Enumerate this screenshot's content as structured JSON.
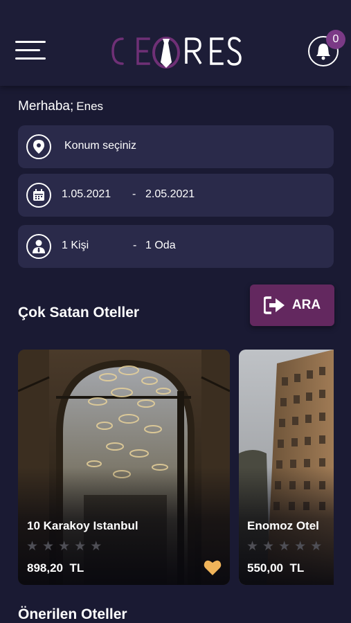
{
  "header": {
    "logo_text": "CEIRES",
    "notification_count": "0"
  },
  "greeting": {
    "label": "Merhaba;",
    "name": "Enes"
  },
  "search": {
    "location_placeholder": "Konum seçiniz",
    "checkin": "1.05.2021",
    "checkout": "2.05.2021",
    "date_separator": "-",
    "guests": "1 Kişi",
    "rooms": "1 Oda",
    "guest_separator": "-",
    "search_button": "ARA"
  },
  "sections": {
    "bestsellers_title": "Çok Satan Oteller",
    "recommended_title": "Önerilen Oteller"
  },
  "hotels": [
    {
      "name": "10 Karakoy Istanbul",
      "price": "898,20",
      "currency": "TL",
      "rating": 0,
      "favorite": true
    },
    {
      "name": "Enomoz Otel",
      "price": "550,00",
      "currency": "TL",
      "rating": 0,
      "favorite": false
    }
  ],
  "colors": {
    "background": "#1a1a33",
    "field": "#2a2a4a",
    "accent": "#63285f",
    "badge": "#7b3a86",
    "favorite": "#f0b45a",
    "star_empty": "#4e4e55"
  },
  "icons": [
    "menu-icon",
    "bell-icon",
    "location-pin-icon",
    "calendar-icon",
    "person-icon",
    "sign-in-icon",
    "star-icon",
    "heart-icon"
  ]
}
